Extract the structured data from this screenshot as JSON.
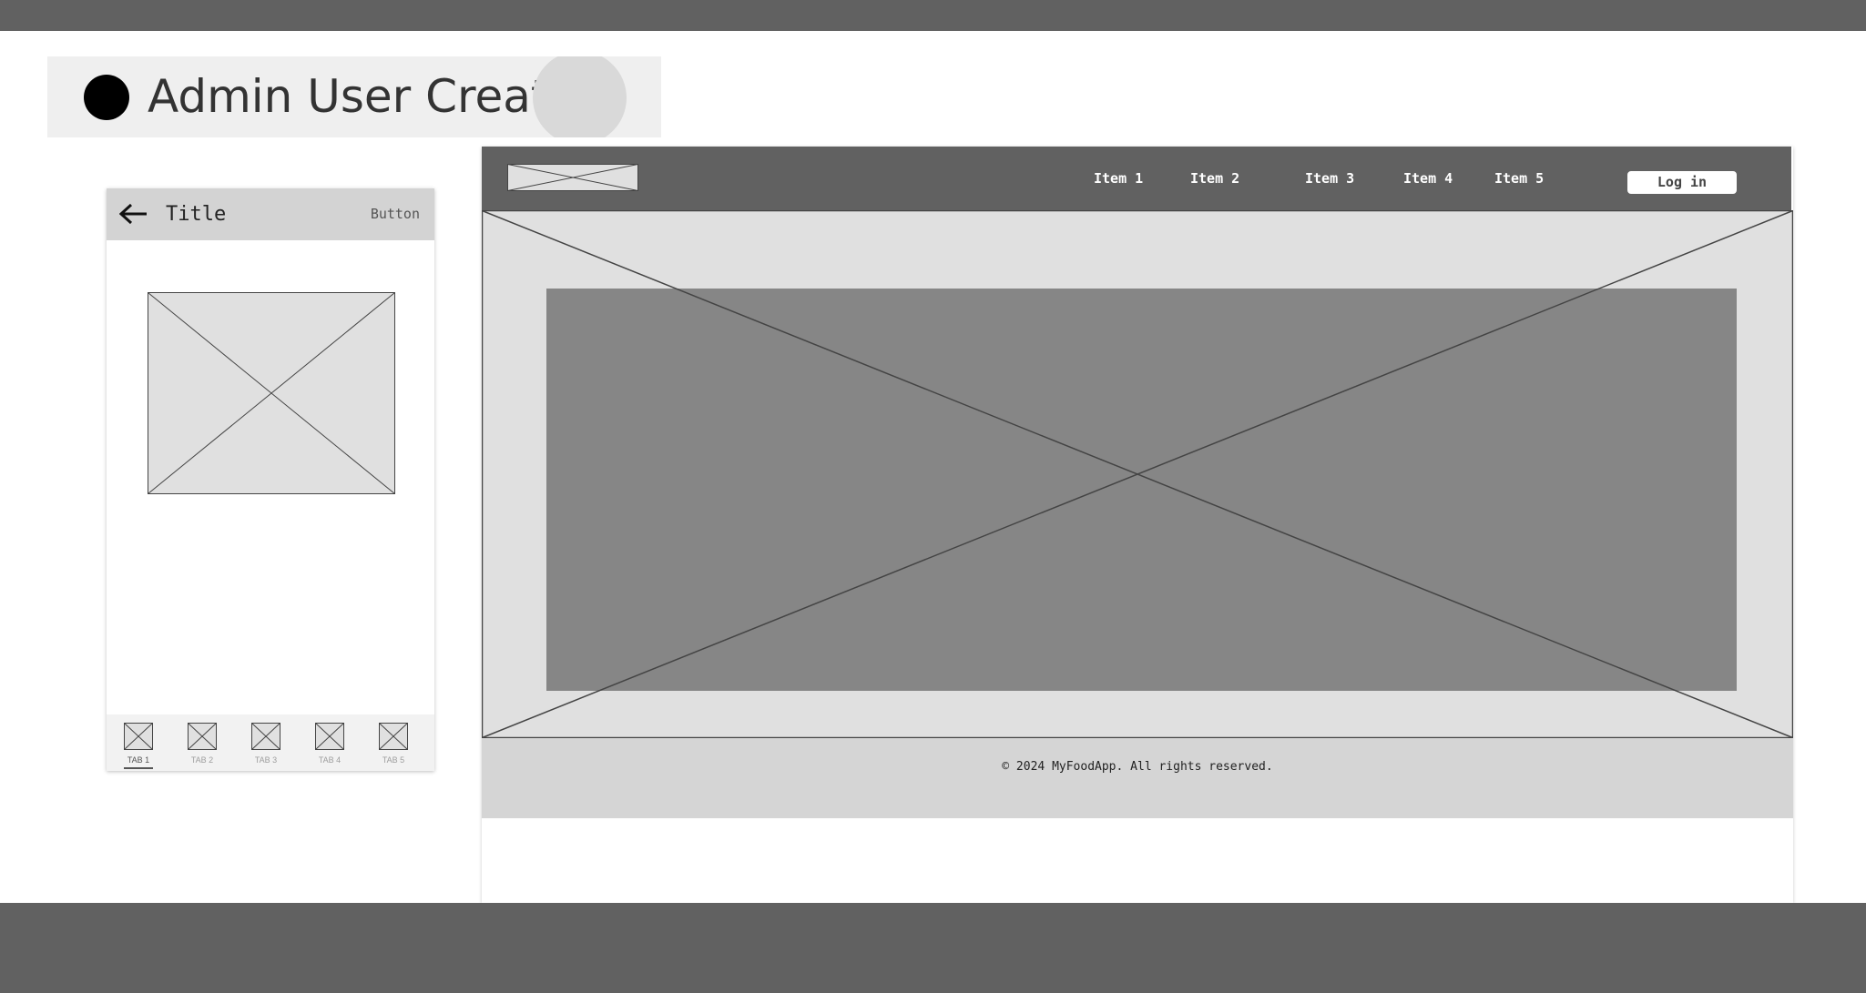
{
  "page": {
    "title": "Admin User Create"
  },
  "mobile": {
    "appbar_title": "Title",
    "appbar_button": "Button",
    "tabs": [
      {
        "label": "TAB 1",
        "active": true
      },
      {
        "label": "TAB 2",
        "active": false
      },
      {
        "label": "TAB 3",
        "active": false
      },
      {
        "label": "TAB 4",
        "active": false
      },
      {
        "label": "TAB 5",
        "active": false
      }
    ]
  },
  "web": {
    "nav_items": [
      "Item 1",
      "Item 2",
      "Item 3",
      "Item 4",
      "Item 5"
    ],
    "login_label": "Log in",
    "footer_text": "© 2024 MyFoodApp. All rights reserved."
  },
  "icons": {
    "back": "arrow-left-icon",
    "placeholder": "image-placeholder-icon"
  },
  "colors": {
    "dark_bar": "#616161",
    "header_bg": "#efefef",
    "placeholder_fill": "#e0e0e0",
    "hero_inner": "#868686",
    "footer_bg": "#d5d5d5"
  }
}
